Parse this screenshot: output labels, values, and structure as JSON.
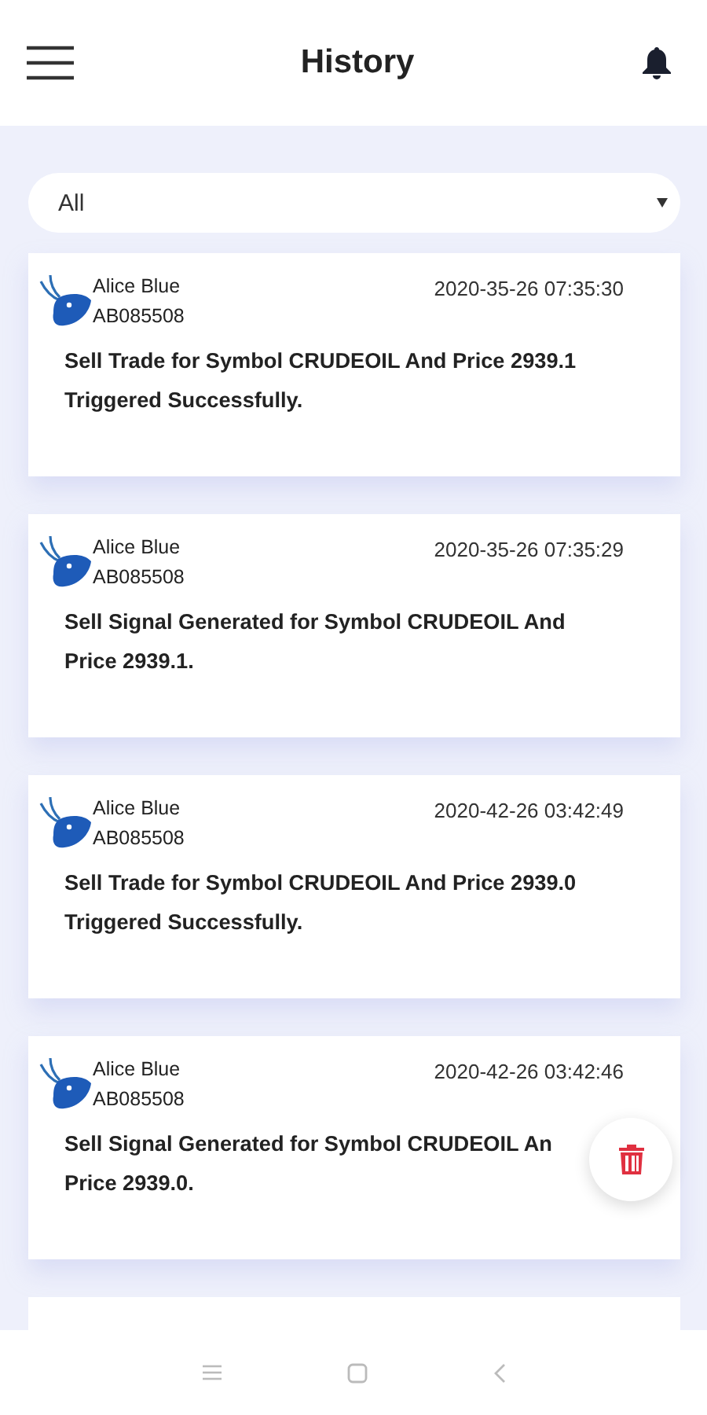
{
  "header": {
    "title": "History"
  },
  "filter": {
    "value": "All"
  },
  "entries": [
    {
      "name": "Alice Blue",
      "account": "AB085508",
      "time": "2020-35-26 07:35:30",
      "lines": [
        "Sell Trade for Symbol CRUDEOIL And Price 2939.1",
        "Triggered Successfully."
      ]
    },
    {
      "name": "Alice Blue",
      "account": "AB085508",
      "time": "2020-35-26 07:35:29",
      "lines": [
        "Sell Signal Generated for Symbol CRUDEOIL And",
        "Price 2939.1."
      ]
    },
    {
      "name": "Alice Blue",
      "account": "AB085508",
      "time": "2020-42-26 03:42:49",
      "lines": [
        "Sell Trade for Symbol CRUDEOIL And Price 2939.0",
        "Triggered Successfully."
      ]
    },
    {
      "name": "Alice Blue",
      "account": "AB085508",
      "time": "2020-42-26 03:42:46",
      "lines": [
        "Sell Signal Generated for Symbol CRUDEOIL An",
        "Price 2939.0."
      ]
    }
  ]
}
